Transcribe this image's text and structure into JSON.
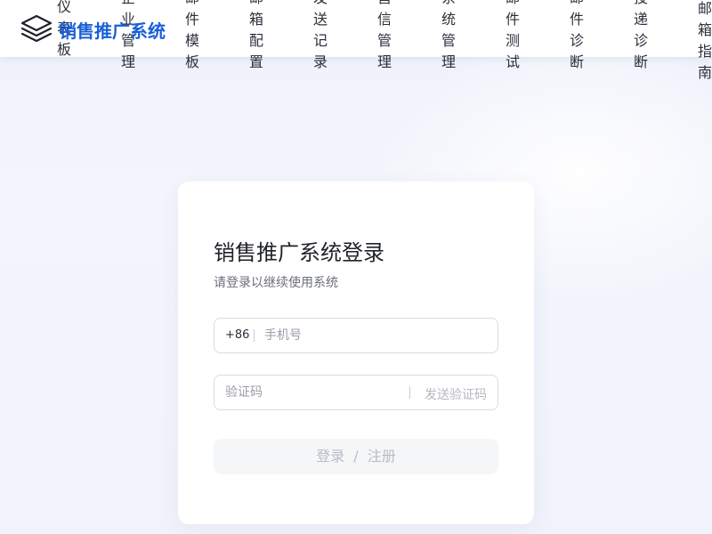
{
  "header": {
    "brand": "销售推广系统",
    "nav": [
      {
        "label": "仪表板"
      },
      {
        "label": "企业管理"
      },
      {
        "label": "邮件模板"
      },
      {
        "label": "邮箱配置"
      },
      {
        "label": "发送记录"
      },
      {
        "label": "营信管理"
      },
      {
        "label": "系统管理"
      },
      {
        "label": "邮件测试"
      },
      {
        "label": "邮件诊断"
      },
      {
        "label": "投递诊断"
      },
      {
        "label": "邮箱指南"
      }
    ]
  },
  "login": {
    "title": "销售推广系统登录",
    "subtitle": "请登录以继续使用系统",
    "phone_prefix": "+86",
    "phone_placeholder": "手机号",
    "code_placeholder": "验证码",
    "send_code_label": "发送验证码",
    "submit_login": "登录",
    "submit_sep": "/",
    "submit_register": "注册"
  },
  "colors": {
    "brand": "#1a5fd8",
    "background": "#eef1fb",
    "button_disabled_bg": "#f5f6f8"
  },
  "icons": {
    "logo": "layers-icon"
  }
}
